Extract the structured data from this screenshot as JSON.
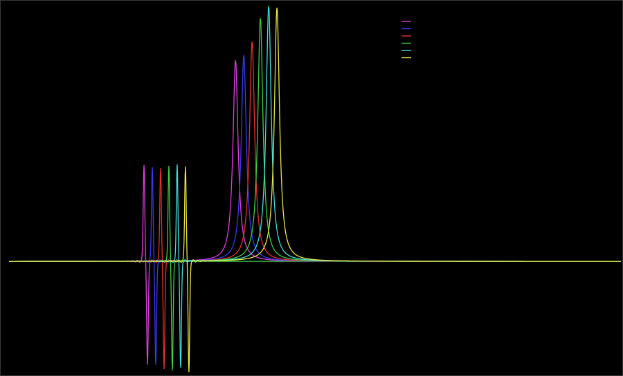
{
  "chart_data": {
    "type": "line",
    "title": "",
    "xlabel": "",
    "ylabel": "",
    "grid": false,
    "legend_position": "top-right",
    "background": "#000000",
    "x_range": [
      0,
      900
    ],
    "y_range": [
      -150,
      340
    ],
    "baseline": 0,
    "series": [
      {
        "color": "#e040e0",
        "dispersive_center": 210,
        "dispersive_amp_up": 130,
        "dispersive_amp_down": 140,
        "absorptive_center": 340,
        "absorptive_peak": 268
      },
      {
        "color": "#3a3af5",
        "dispersive_center": 222,
        "dispersive_amp_up": 127,
        "dispersive_amp_down": 140,
        "absorptive_center": 352,
        "absorptive_peak": 275
      },
      {
        "color": "#e83030",
        "dispersive_center": 234,
        "dispersive_amp_up": 126,
        "dispersive_amp_down": 146,
        "absorptive_center": 364,
        "absorptive_peak": 293
      },
      {
        "color": "#40d040",
        "dispersive_center": 246,
        "dispersive_amp_up": 129,
        "dispersive_amp_down": 148,
        "absorptive_center": 376,
        "absorptive_peak": 324
      },
      {
        "color": "#40e0e0",
        "dispersive_center": 258,
        "dispersive_amp_up": 131,
        "dispersive_amp_down": 144,
        "absorptive_center": 388,
        "absorptive_peak": 340
      },
      {
        "color": "#e8e840",
        "dispersive_center": 270,
        "dispersive_amp_up": 128,
        "dispersive_amp_down": 150,
        "absorptive_center": 400,
        "absorptive_peak": 338
      }
    ]
  }
}
